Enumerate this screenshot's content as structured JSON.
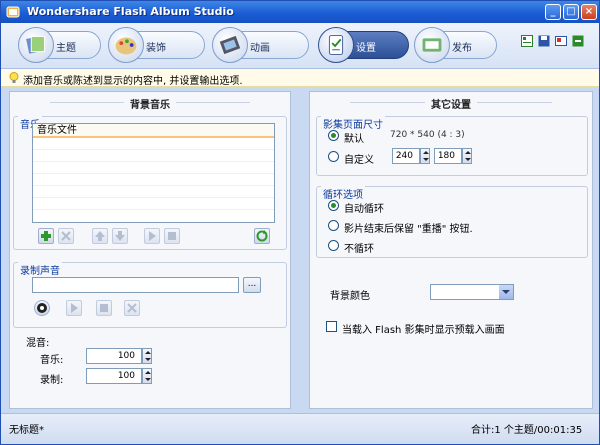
{
  "app": {
    "title": "Wondershare Flash Album Studio"
  },
  "window_controls": {
    "minimize": "_",
    "maximize": "□",
    "close": "×"
  },
  "tabs": [
    {
      "label": "主题",
      "icon": "theme-icon"
    },
    {
      "label": "装饰",
      "icon": "palette-icon"
    },
    {
      "label": "动画",
      "icon": "film-icon"
    },
    {
      "label": "设置",
      "icon": "settings-icon",
      "active": true
    },
    {
      "label": "发布",
      "icon": "publish-icon"
    }
  ],
  "hint": {
    "text": "添加音乐或陈述到显示的内容中, 并设置输出选项."
  },
  "left": {
    "title": "背景音乐",
    "music_group": "音乐",
    "music_header": "音乐文件",
    "record_group": "录制声音",
    "browse_label": "...",
    "mix": {
      "title": "混音:",
      "music_label": "音乐:",
      "music_value": "100",
      "record_label": "录制:",
      "record_value": "100"
    }
  },
  "right": {
    "title": "其它设置",
    "size_group": "影集页面尺寸",
    "size_default_label": "默认",
    "size_default_value": "720 * 540 (4 : 3)",
    "size_custom_label": "自定义",
    "width_value": "240",
    "height_value": "180",
    "loop_group": "循环选项",
    "loop_auto": "自动循环",
    "loop_keep": "影片结束后保留 \"重播\" 按钮.",
    "loop_none": "不循环",
    "bg_color_label": "背景颜色",
    "preload_label": "当载入 Flash 影集时显示预载入画面"
  },
  "status": {
    "left": "无标题*",
    "right": "合计:1 个主题/00:01:35"
  },
  "colors": {
    "title_bar": "#1a5ad3",
    "active_tab": "#2c4f97",
    "panel_bg": "#f5f7fb",
    "window_bg": "#c9d9f2"
  }
}
